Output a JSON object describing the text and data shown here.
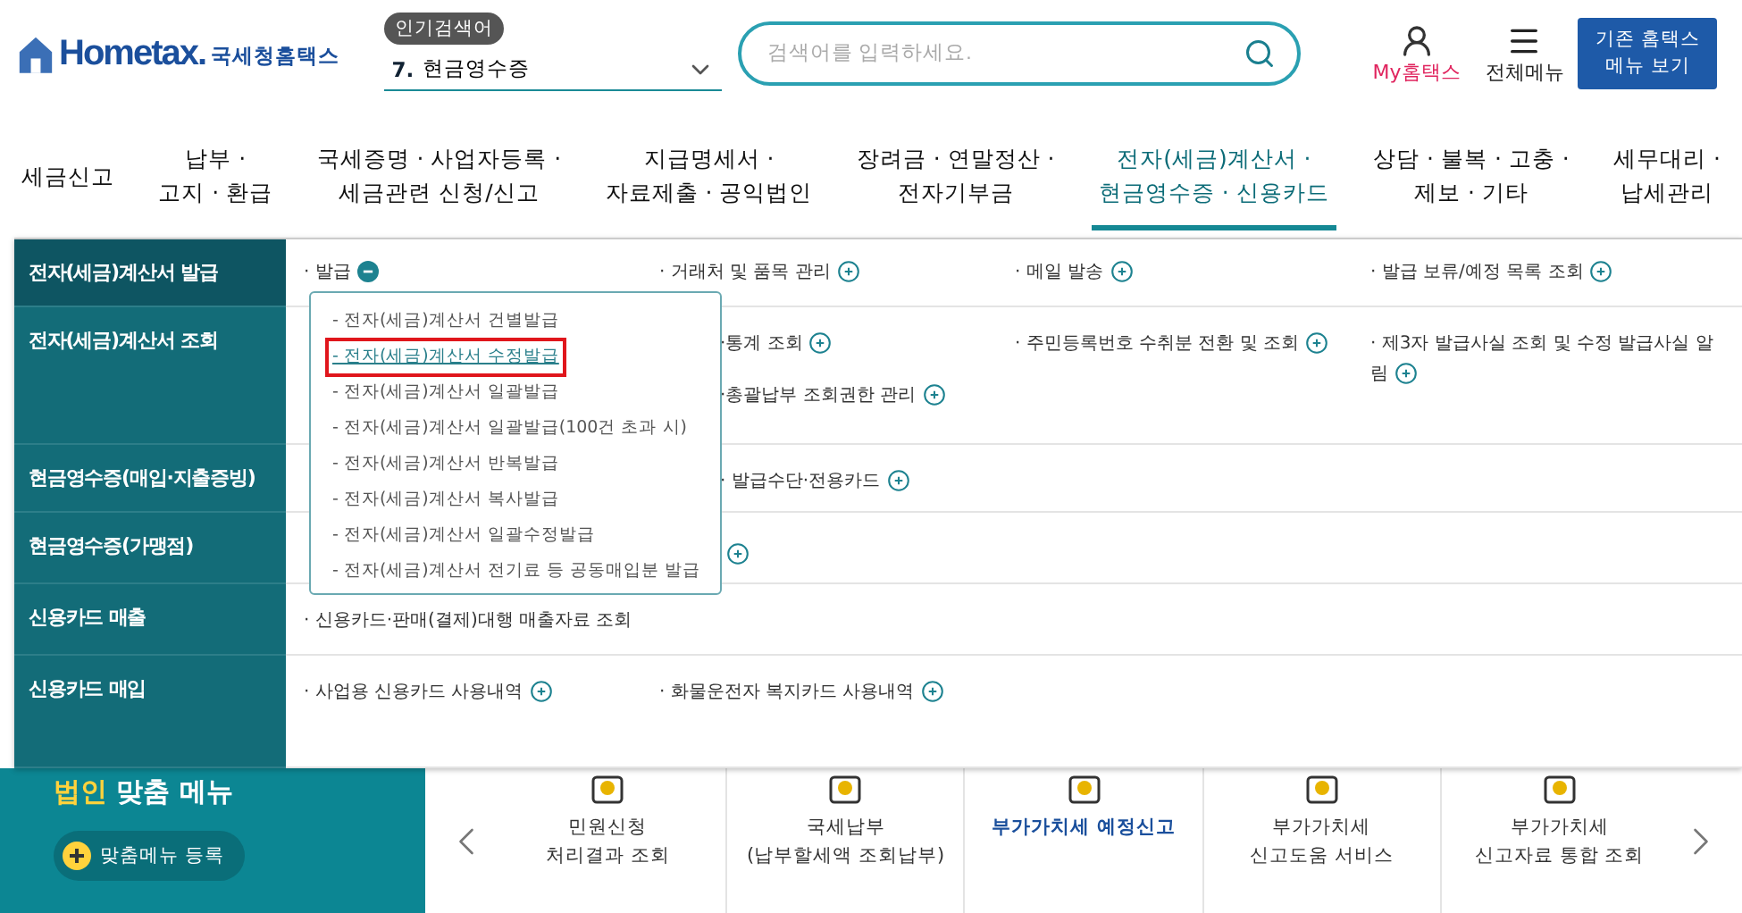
{
  "header": {
    "logo": "Hometax.",
    "logo_sub": "국세청홈택스",
    "popular_label": "인기검색어",
    "popular": {
      "rank": "7.",
      "term": "현금영수증"
    },
    "search": {
      "placeholder": "검색어를 입력하세요."
    },
    "my": "My홈택스",
    "all_menu": "전체메뉴",
    "old_menu": "기존 홈택스\n메뉴 보기"
  },
  "nav": [
    {
      "label": "세금신고",
      "selected": false
    },
    {
      "label": "납부 ·\n고지 · 환급",
      "selected": false
    },
    {
      "label": "국세증명 · 사업자등록 ·\n세금관련 신청/신고",
      "selected": false
    },
    {
      "label": "지급명세서 ·\n자료제출 · 공익법인",
      "selected": false
    },
    {
      "label": "장려금 · 연말정산 ·\n전자기부금",
      "selected": false
    },
    {
      "label": "전자(세금)계산서 ·\n현금영수증 · 신용카드",
      "selected": true
    },
    {
      "label": "상담 · 불복 · 고충 ·\n제보 · 기타",
      "selected": false
    },
    {
      "label": "세무대리 ·\n납세관리",
      "selected": false
    }
  ],
  "menu": [
    {
      "label": "전자(세금)계산서 발급",
      "selected": true,
      "columns": [
        [
          {
            "label": "· 발급",
            "expanded": true
          }
        ],
        [
          {
            "label": "· 거래처 및 품목 관리",
            "expanded": false
          }
        ],
        [
          {
            "label": "· 메일 발송",
            "expanded": false
          }
        ],
        [
          {
            "label": "· 발급 보류/예정 목록 조회",
            "expanded": false
          }
        ]
      ]
    },
    {
      "label": "전자(세금)계산서 조회",
      "selected": false,
      "columns": [
        [],
        [
          {
            "label": "·통계 조회",
            "expanded": false
          },
          {
            "label": "·총괄납부 조회권한 관리",
            "expanded": false
          }
        ],
        [
          {
            "label": "· 주민등록번호 수취분 전환 및 조회",
            "expanded": false
          }
        ],
        [
          {
            "label": "· 제3자 발급사실 조회 및 수정 발급사실 알림",
            "expanded": false
          }
        ]
      ]
    },
    {
      "label": "현금영수증(매입·지출증빙)",
      "selected": false,
      "columns": [
        [],
        [
          {
            "label": "· 발급수단·전용카드",
            "expanded": false
          }
        ]
      ]
    },
    {
      "label": "현금영수증(가맹점)",
      "selected": false,
      "columns": [
        [],
        [
          {
            "expanded": false
          }
        ]
      ]
    },
    {
      "label": "신용카드 매출",
      "selected": false,
      "columns": [
        [
          {
            "label": "· 신용카드·판매(결제)대행 매출자료 조회"
          }
        ]
      ]
    },
    {
      "label": "신용카드 매입",
      "selected": false,
      "columns": [
        [
          {
            "label": "· 사업용 신용카드 사용내역",
            "expanded": false
          }
        ],
        [
          {
            "label": "· 화물운전자 복지카드 사용내역",
            "expanded": false
          }
        ]
      ]
    }
  ],
  "popup": [
    {
      "label": "- 전자(세금)계산서 건별발급",
      "selected": false
    },
    {
      "label": "- 전자(세금)계산서 수정발급",
      "selected": true
    },
    {
      "label": "- 전자(세금)계산서 일괄발급",
      "selected": false
    },
    {
      "label": "- 전자(세금)계산서 일괄발급(100건 초과 시)",
      "selected": false
    },
    {
      "label": "- 전자(세금)계산서 반복발급",
      "selected": false
    },
    {
      "label": "- 전자(세금)계산서 복사발급",
      "selected": false
    },
    {
      "label": "- 전자(세금)계산서 일괄수정발급",
      "selected": false
    },
    {
      "label": "- 전자(세금)계산서 전기료 등 공동매입분 발급",
      "selected": false
    }
  ],
  "custom": {
    "title_accent": "법인",
    "title": "맞춤 메뉴",
    "add": "맞춤메뉴 등록"
  },
  "quick": [
    {
      "label": "민원신청\n처리결과 조회",
      "selected": false
    },
    {
      "label": "국세납부\n(납부할세액 조회납부)",
      "selected": false
    },
    {
      "label": "부가가치세 예정신고",
      "selected": true
    },
    {
      "label": "부가가치세\n신고도움 서비스",
      "selected": false
    },
    {
      "label": "부가가치세\n신고자료 통합 조회",
      "selected": false
    }
  ]
}
